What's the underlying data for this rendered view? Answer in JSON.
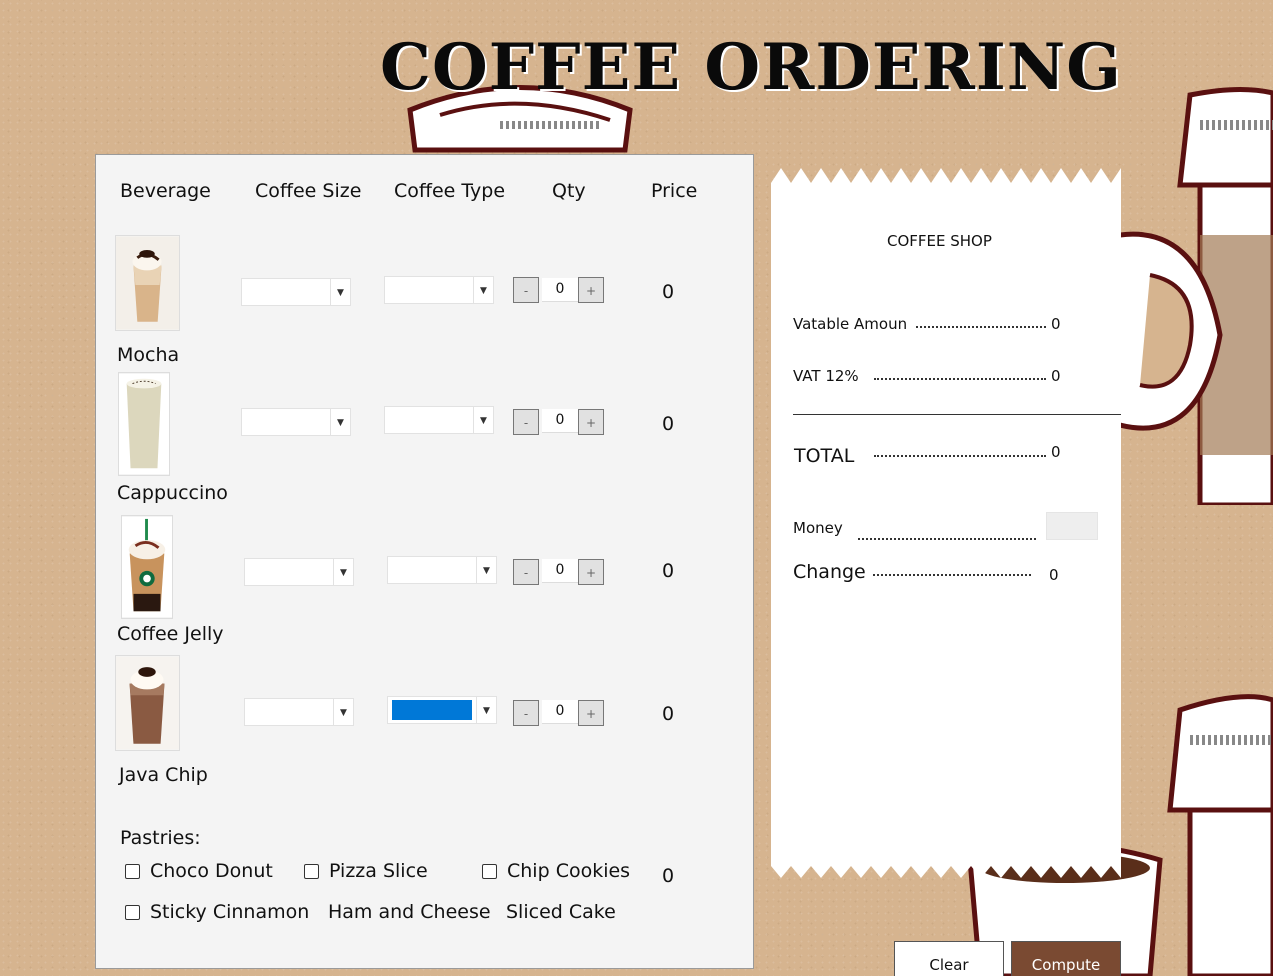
{
  "app": {
    "title": "COFFEE ORDERING"
  },
  "columns": {
    "beverage": "Beverage",
    "coffee_size": "Coffee Size",
    "coffee_type": "Coffee Type",
    "qty": "Qty",
    "price": "Price"
  },
  "products": [
    {
      "name": "Mocha",
      "qty": "0",
      "price": "0",
      "minus": "-",
      "plus": "+",
      "type_selected": false
    },
    {
      "name": "Cappuccino",
      "qty": "0",
      "price": "0",
      "minus": "-",
      "plus": "+",
      "type_selected": false
    },
    {
      "name": "Coffee Jelly",
      "qty": "0",
      "price": "0",
      "minus": "-",
      "plus": "+",
      "type_selected": false
    },
    {
      "name": "Java Chip",
      "qty": "0",
      "price": "0",
      "minus": "-",
      "plus": "+",
      "type_selected": true
    }
  ],
  "pastries": {
    "label": "Pastries:",
    "items": [
      "Choco Donut",
      "Pizza Slice",
      "Chip Cookies",
      "Sticky Cinnamon",
      "Ham and Cheese",
      "Sliced Cake"
    ],
    "price": "0"
  },
  "receipt": {
    "title": "COFFEE SHOP",
    "vatable_label": "Vatable Amoun",
    "vatable_value": "0",
    "vat_label": "VAT 12%",
    "vat_value": "0",
    "total_label": "TOTAL",
    "total_value": "0",
    "money_label": "Money",
    "money_value": "",
    "change_label": "Change",
    "change_value": "0"
  },
  "buttons": {
    "clear": "Clear",
    "compute": "Compute"
  },
  "colors": {
    "accent": "#0078d7",
    "compute": "#7a4a32",
    "background": "#d6b48f",
    "cup_outline": "#6b1a1a"
  }
}
